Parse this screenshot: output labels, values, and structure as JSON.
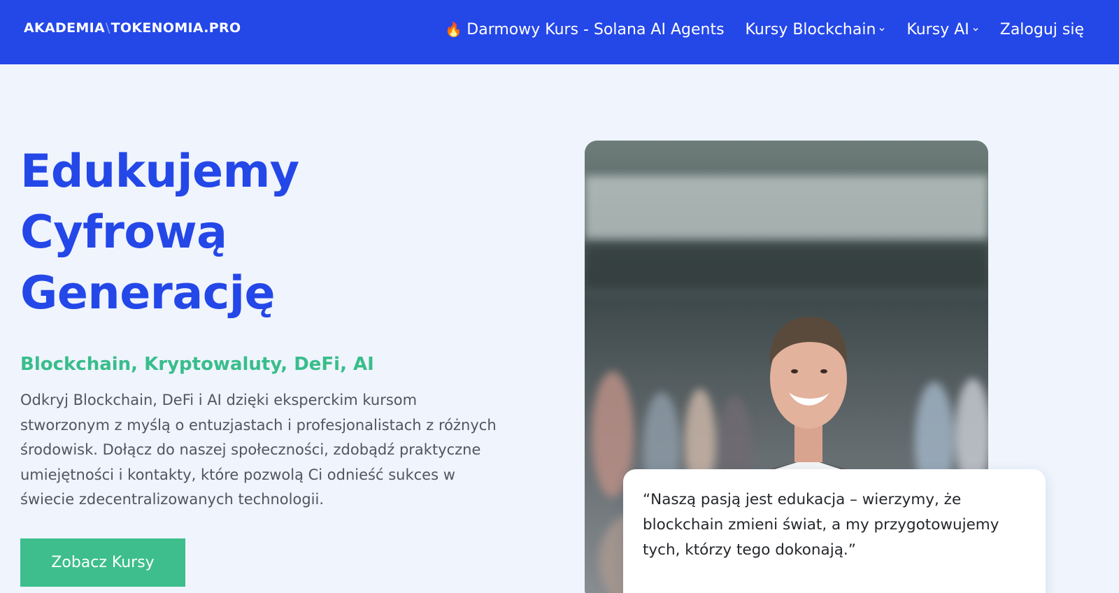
{
  "header": {
    "logo": {
      "part1": "AKADEMIA",
      "separator": "\\",
      "part2": "TOKENOMIA.PRO"
    },
    "nav": [
      {
        "label": "Darmowy Kurs - Solana AI Agents",
        "icon": "fire-icon"
      },
      {
        "label": "Kursy Blockchain",
        "icon": "chevron-down-icon"
      },
      {
        "label": "Kursy AI",
        "icon": "chevron-down-icon"
      },
      {
        "label": "Zaloguj się"
      }
    ]
  },
  "hero": {
    "title_lines": [
      "Edukujemy",
      "Cyfrową",
      "Generację"
    ],
    "subtitle": "Blockchain, Kryptowaluty, DeFi, AI",
    "description": "Odkryj Blockchain, DeFi i AI dzięki eksperckim kursom stworzonym z myślą o entuzjastach i profesjonalistach z różnych środowisk. Dołącz do naszej społeczności, zdobądź praktyczne umiejętności i kontakty, które pozwolą Ci odnieść sukces w świecie zdecentralizowanych technologii.",
    "cta_label": "Zobacz Kursy"
  },
  "quote": {
    "text": "“Naszą pasją jest edukacja – wierzymy, że blockchain zmieni świat, a my przygotowujemy tych, którzy tego dokonają.”"
  },
  "colors": {
    "brand_blue": "#2447e8",
    "accent_green": "#3dbe8c",
    "page_background": "#eff4fd"
  }
}
